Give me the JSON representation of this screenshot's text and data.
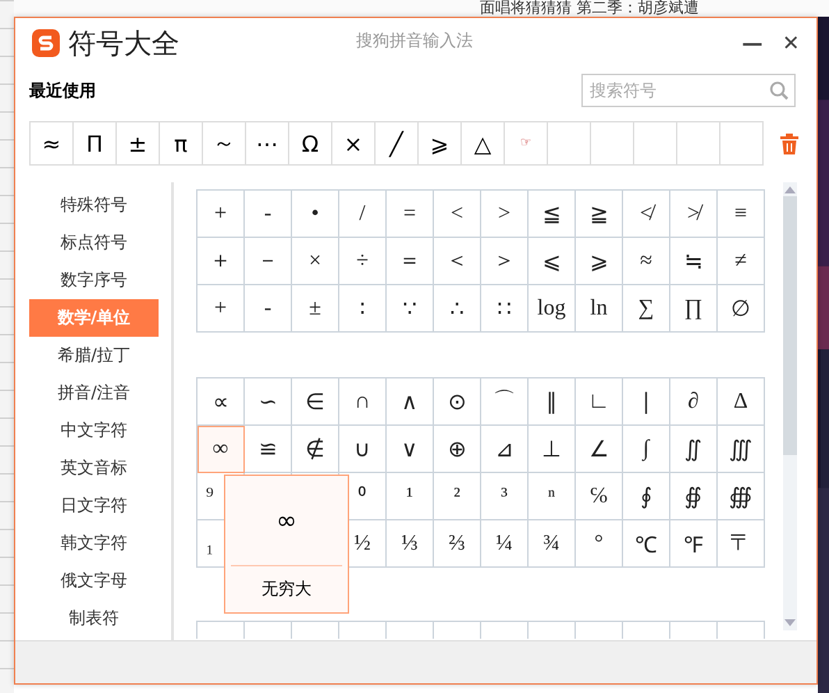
{
  "background": {
    "caption": "面唱将猜猜猜 第二季：胡彦斌遭"
  },
  "window": {
    "title": "符号大全",
    "subtitle": "搜狗拼音输入法",
    "minimize": "—",
    "close": "✕"
  },
  "recent": {
    "label": "最近使用",
    "search": {
      "placeholder": "搜索符号"
    },
    "symbols": [
      "≈",
      "Π",
      "±",
      "π",
      "～",
      "⋯",
      "Ω",
      "×",
      "╱",
      "⩾",
      "△",
      "☞"
    ]
  },
  "sidebar": {
    "items": [
      {
        "label": "特殊符号",
        "selected": false
      },
      {
        "label": "标点符号",
        "selected": false
      },
      {
        "label": "数字序号",
        "selected": false
      },
      {
        "label": "数学/单位",
        "selected": true
      },
      {
        "label": "希腊/拉丁",
        "selected": false
      },
      {
        "label": "拼音/注音",
        "selected": false
      },
      {
        "label": "中文字符",
        "selected": false
      },
      {
        "label": "英文音标",
        "selected": false
      },
      {
        "label": "日文字符",
        "selected": false
      },
      {
        "label": "韩文字符",
        "selected": false
      },
      {
        "label": "俄文字母",
        "selected": false
      },
      {
        "label": "制表符",
        "selected": false
      }
    ]
  },
  "grids": [
    {
      "cells": [
        {
          "symbol": "+",
          "selected": false
        },
        {
          "symbol": "-",
          "selected": false
        },
        {
          "symbol": "•",
          "selected": false
        },
        {
          "symbol": "/",
          "selected": false
        },
        {
          "symbol": "=",
          "selected": false
        },
        {
          "symbol": "<",
          "selected": false
        },
        {
          "symbol": ">",
          "selected": false
        },
        {
          "symbol": "≦",
          "selected": false
        },
        {
          "symbol": "≧",
          "selected": false
        },
        {
          "symbol": "≮",
          "selected": false
        },
        {
          "symbol": "≯",
          "selected": false
        },
        {
          "symbol": "≡",
          "selected": false
        },
        {
          "symbol": "＋",
          "selected": false
        },
        {
          "symbol": "－",
          "selected": false
        },
        {
          "symbol": "×",
          "selected": false
        },
        {
          "symbol": "÷",
          "selected": false
        },
        {
          "symbol": "＝",
          "selected": false
        },
        {
          "symbol": "＜",
          "selected": false
        },
        {
          "symbol": "＞",
          "selected": false
        },
        {
          "symbol": "⩽",
          "selected": false
        },
        {
          "symbol": "⩾",
          "selected": false
        },
        {
          "symbol": "≈",
          "selected": false
        },
        {
          "symbol": "≒",
          "selected": false
        },
        {
          "symbol": "≠",
          "selected": false
        },
        {
          "symbol": "+",
          "selected": false
        },
        {
          "symbol": "-",
          "selected": false
        },
        {
          "symbol": "±",
          "selected": false
        },
        {
          "symbol": "∶",
          "selected": false
        },
        {
          "symbol": "∵",
          "selected": false
        },
        {
          "symbol": "∴",
          "selected": false
        },
        {
          "symbol": "∷",
          "selected": false
        },
        {
          "symbol": "log",
          "selected": false
        },
        {
          "symbol": "ln",
          "selected": false
        },
        {
          "symbol": "∑",
          "selected": false
        },
        {
          "symbol": "∏",
          "selected": false
        },
        {
          "symbol": "∅",
          "selected": false
        }
      ]
    },
    {
      "cells": [
        {
          "symbol": "∝",
          "selected": false
        },
        {
          "symbol": "∽",
          "selected": false
        },
        {
          "symbol": "∈",
          "selected": false
        },
        {
          "symbol": "∩",
          "selected": false
        },
        {
          "symbol": "∧",
          "selected": false
        },
        {
          "symbol": "⊙",
          "selected": false
        },
        {
          "symbol": "⌒",
          "selected": false
        },
        {
          "symbol": "∥",
          "selected": false
        },
        {
          "symbol": "∟",
          "selected": false
        },
        {
          "symbol": "∣",
          "selected": false
        },
        {
          "symbol": "∂",
          "selected": false
        },
        {
          "symbol": "∆",
          "selected": false
        },
        {
          "symbol": "∞",
          "selected": true
        },
        {
          "symbol": "≌",
          "selected": false
        },
        {
          "symbol": "∉",
          "selected": false
        },
        {
          "symbol": "∪",
          "selected": false
        },
        {
          "symbol": "∨",
          "selected": false
        },
        {
          "symbol": "⊕",
          "selected": false
        },
        {
          "symbol": "⊿",
          "selected": false
        },
        {
          "symbol": "⊥",
          "selected": false
        },
        {
          "symbol": "∠",
          "selected": false
        },
        {
          "symbol": "∫",
          "selected": false
        },
        {
          "symbol": "∬",
          "selected": false
        },
        {
          "symbol": "∭",
          "selected": false
        },
        {
          "symbol": "⁹",
          "selected": false
        },
        {},
        {},
        {
          "symbol": "⁰",
          "selected": false
        },
        {
          "symbol": "¹",
          "selected": false
        },
        {
          "symbol": "²",
          "selected": false
        },
        {
          "symbol": "³",
          "selected": false
        },
        {
          "symbol": "ⁿ",
          "selected": false
        },
        {
          "symbol": "℅",
          "selected": false
        },
        {
          "symbol": "∮",
          "selected": false
        },
        {
          "symbol": "∯",
          "selected": false
        },
        {
          "symbol": "∰",
          "selected": false
        },
        {
          "symbol": "₁",
          "selected": false
        },
        {},
        {},
        {
          "symbol": "½",
          "selected": false
        },
        {
          "symbol": "⅓",
          "selected": false
        },
        {
          "symbol": "⅔",
          "selected": false
        },
        {
          "symbol": "¼",
          "selected": false
        },
        {
          "symbol": "¾",
          "selected": false
        },
        {
          "symbol": "°",
          "selected": false
        },
        {
          "symbol": "℃",
          "selected": false
        },
        {
          "symbol": "℉",
          "selected": false
        },
        {
          "symbol": "〒",
          "selected": false
        }
      ]
    }
  ],
  "tooltip": {
    "symbol": "∞",
    "name": "无穷大"
  }
}
